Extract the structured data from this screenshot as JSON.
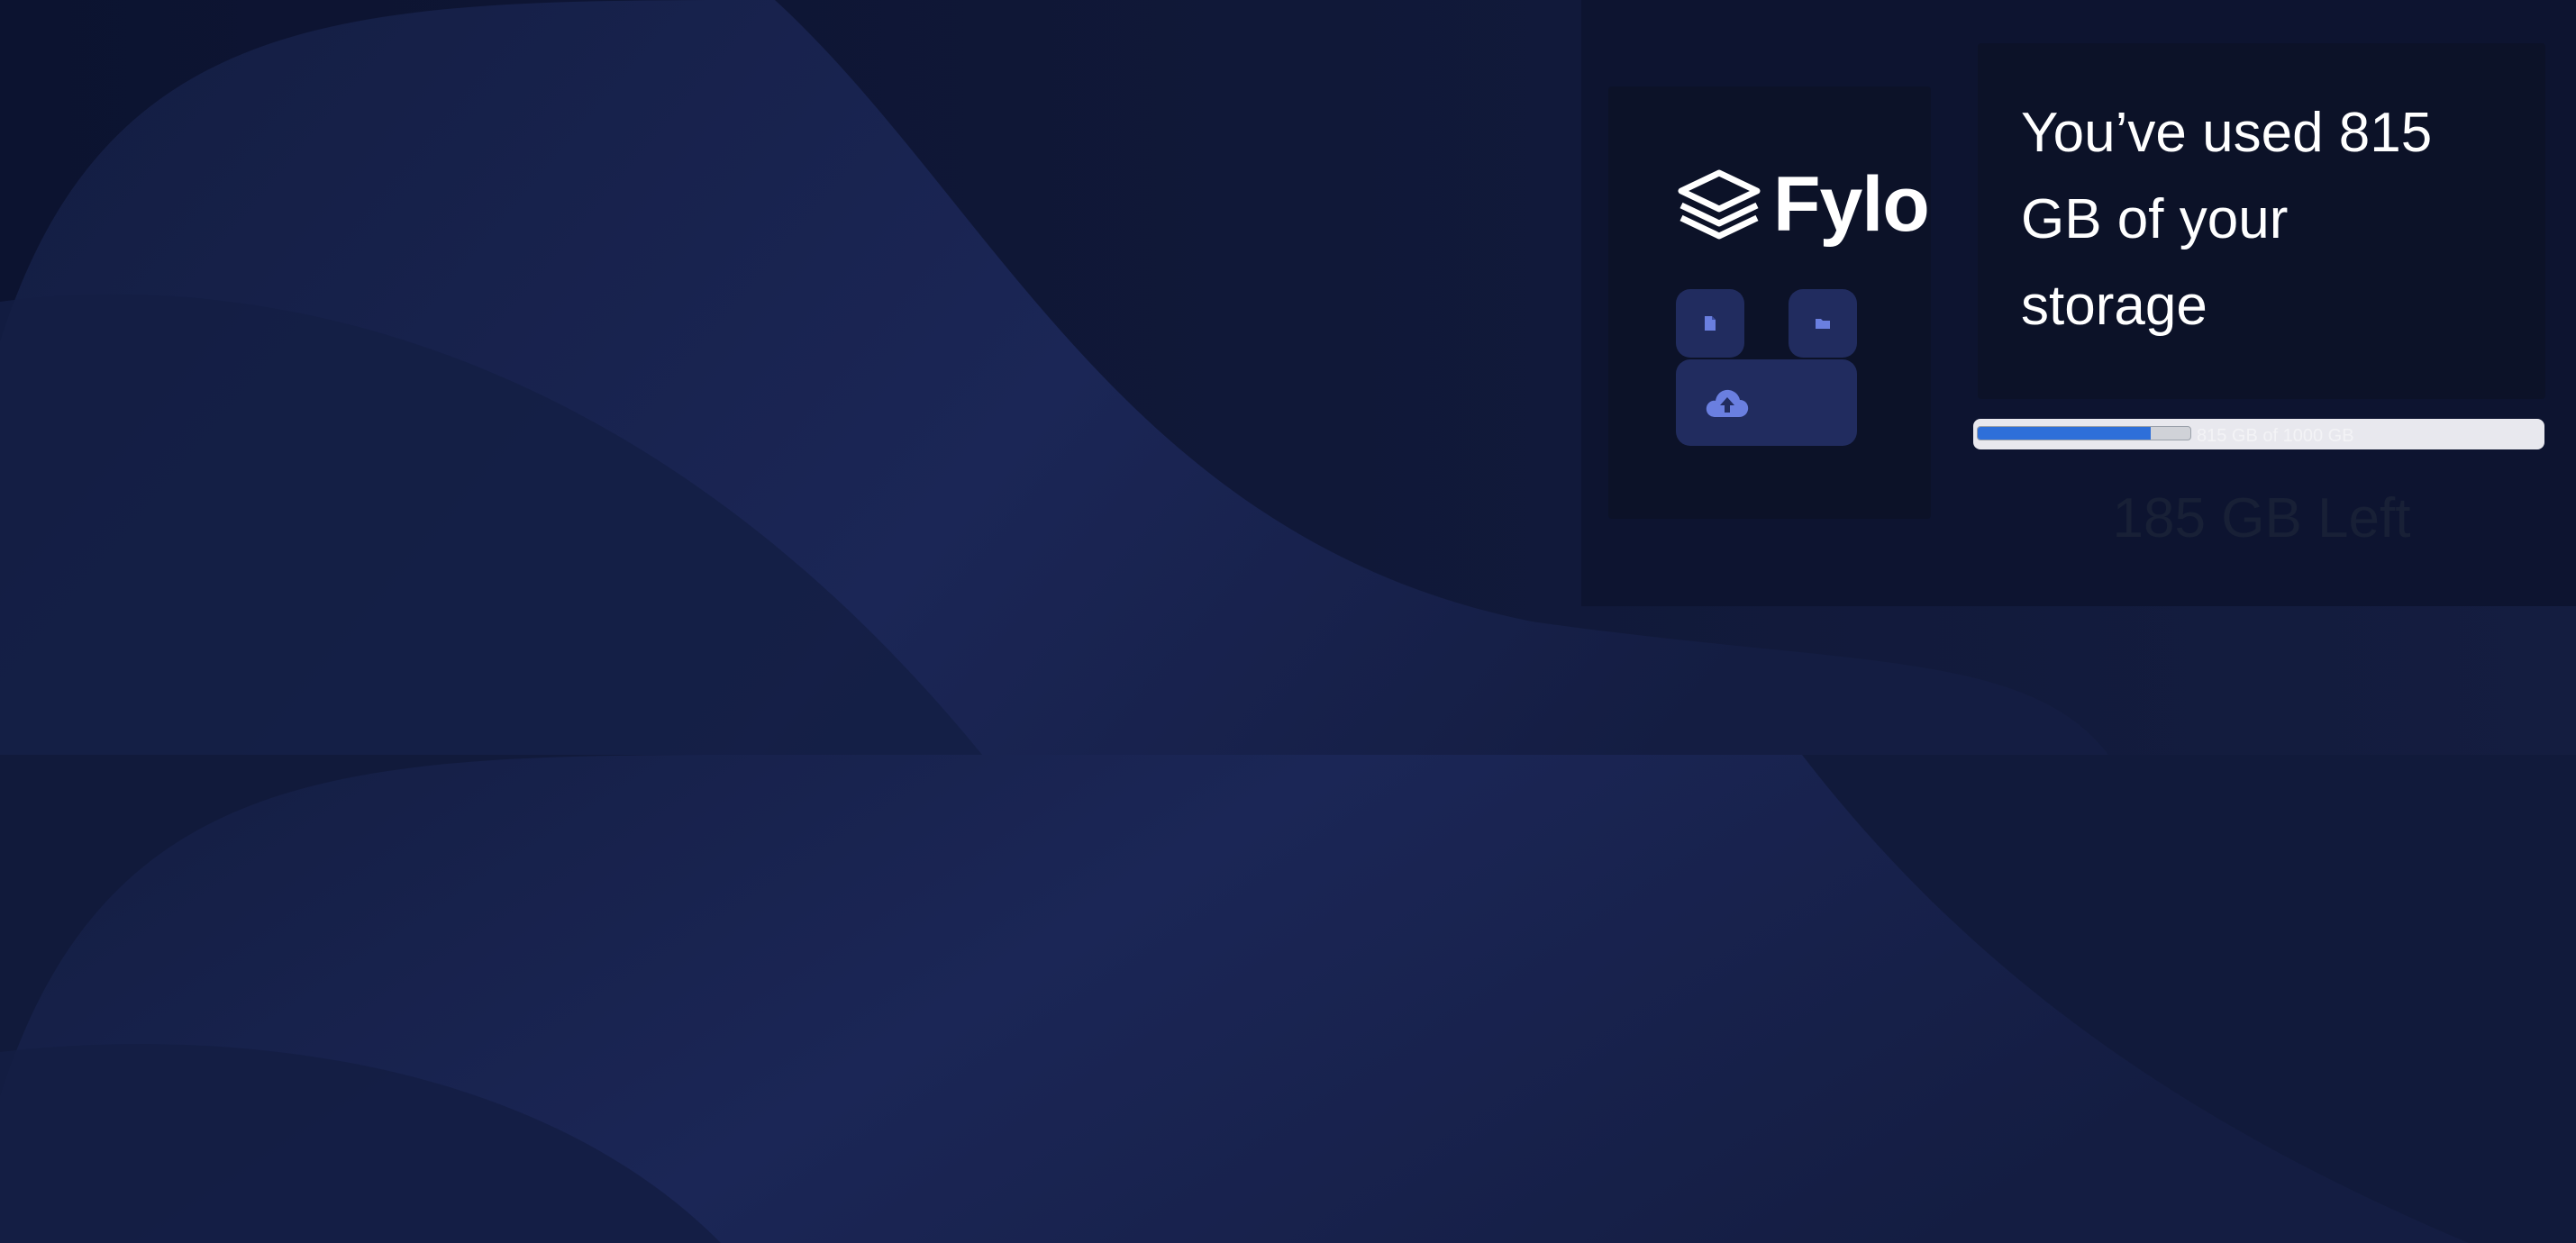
{
  "brand": {
    "name": "Fylo",
    "logo_icon": "stacked-layers-icon"
  },
  "actions": {
    "doc_icon": "document-icon",
    "folder_icon": "folder-icon",
    "upload_icon": "cloud-upload-icon"
  },
  "storage": {
    "used_text": "You’ve used 815 GB of your storage",
    "progress_fraction": 0.815,
    "progress_caption": "815 GB of 1000 GB",
    "left_text": "185 GB Left"
  },
  "colors": {
    "page_background": "#121b3a",
    "wave": "#1b2653",
    "card": "#0c1228",
    "tile": "#212c5f",
    "accent_icon": "#6a7fe0",
    "progress": "#2e6fd9"
  }
}
